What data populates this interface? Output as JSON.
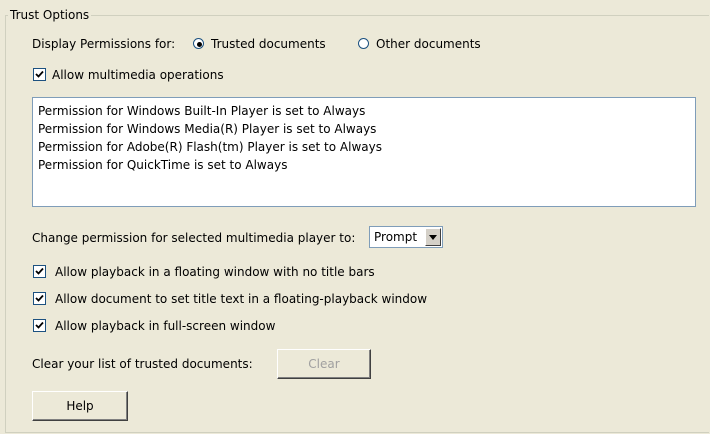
{
  "group": {
    "title": "Trust Options"
  },
  "display_permissions": {
    "label": "Display Permissions for:",
    "options": [
      {
        "label": "Trusted documents",
        "selected": true
      },
      {
        "label": "Other documents",
        "selected": false
      }
    ]
  },
  "allow_multimedia": {
    "label": "Allow multimedia operations",
    "checked": true
  },
  "permissions_list": [
    "Permission for Windows Built-In Player is set to Always",
    "Permission for Windows Media(R) Player is set to Always",
    "Permission for Adobe(R) Flash(tm) Player is set to Always",
    "Permission for QuickTime is set to Always"
  ],
  "change_permission": {
    "label": "Change permission for selected multimedia player to:",
    "selected": "Prompt"
  },
  "playback_options": [
    {
      "label": "Allow playback in a floating window with no title bars",
      "checked": true
    },
    {
      "label": "Allow document to set title text in a floating-playback window",
      "checked": true
    },
    {
      "label": "Allow playback in full-screen window",
      "checked": true
    }
  ],
  "clear_trusted": {
    "label": "Clear your list of trusted documents:",
    "button_label": "Clear",
    "enabled": false
  },
  "help_button": {
    "label": "Help"
  },
  "icons": {
    "radio": "radio-button-icon",
    "checkbox": "checkmark-icon",
    "dropdown": "triangle-down-icon"
  }
}
